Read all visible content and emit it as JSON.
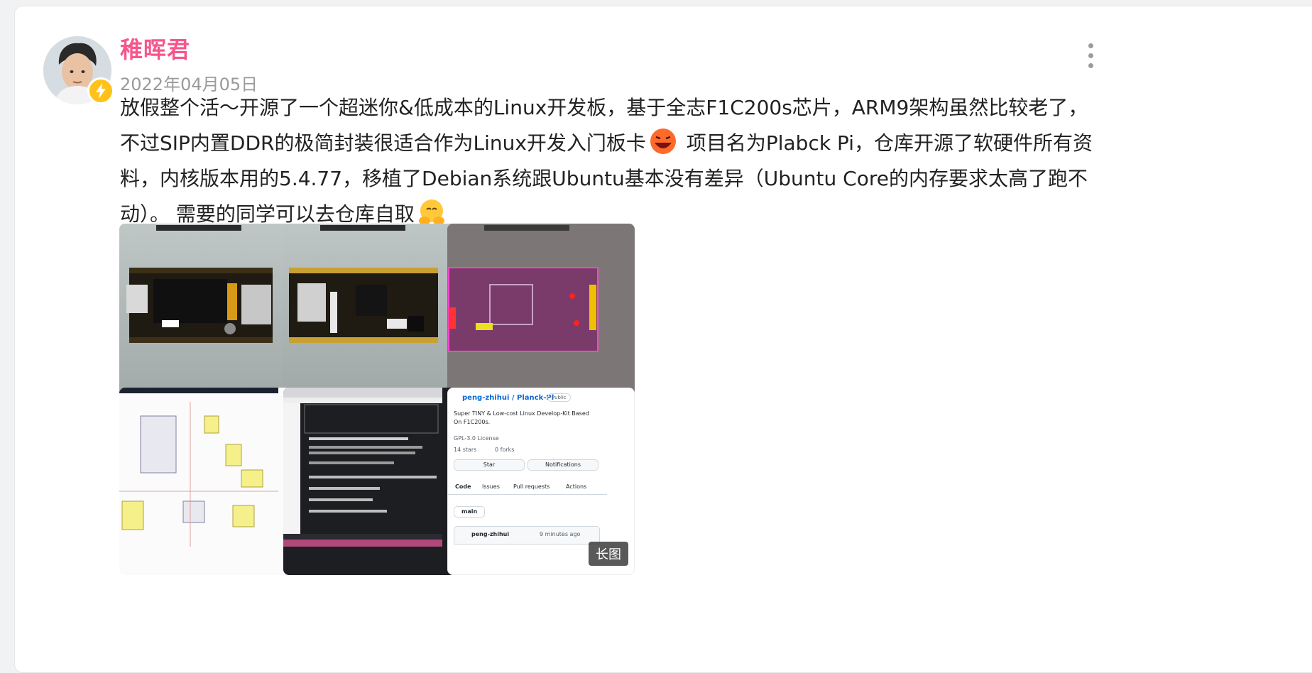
{
  "author": {
    "name": "稚晖君",
    "date": "2022年04月05日"
  },
  "post": {
    "text_part1": "放假整个活～开源了一个超迷你&低成本的Linux开发板，基于全志F1C200s芯片，ARM9架构虽然比较老了，不过SIP内置DDR的极简封装很适合作为Linux开发入门板卡",
    "text_part2": "项目名为Plabck Pi，仓库开源了软硬件所有资料，内核版本用的5.4.77，移植了Debian系统跟Ubuntu基本没有差异（Ubuntu Core的内存要求太高了跑不动）。 需要的同学可以去仓库自取"
  },
  "images": {
    "long_image_tag": "长图"
  },
  "github_card": {
    "owner": "peng-zhihui",
    "repo": "Planck-Pi",
    "visibility": "Public",
    "description": "Super TINY & Low-cost Linux Develop-Kit Based On F1C200s.",
    "license": "GPL-3.0 License",
    "stars": "14 stars",
    "forks": "0 forks",
    "star_button": "Star",
    "notifications_button": "Notifications",
    "tabs": [
      "Code",
      "Issues",
      "Pull requests",
      "Actions"
    ],
    "branch": "main",
    "commit_user": "peng-zhihui",
    "commit_time": "9 minutes ago"
  },
  "colors": {
    "name": "#f5578d",
    "date": "#9a9a9a",
    "badge": "#ffc21a"
  }
}
